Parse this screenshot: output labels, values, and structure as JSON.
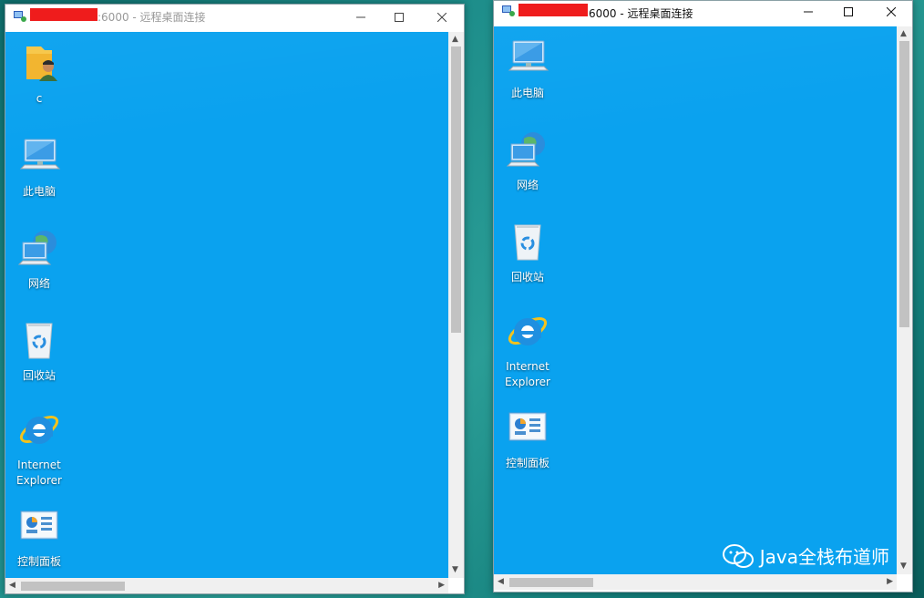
{
  "windows": [
    {
      "title_suffix": ":6000 - 远程桌面连接",
      "icons": [
        {
          "label": "c"
        },
        {
          "label": "此电脑"
        },
        {
          "label": "网络"
        },
        {
          "label": "回收站"
        },
        {
          "label": "Internet Explorer"
        },
        {
          "label": "控制面板"
        }
      ]
    },
    {
      "title_suffix": "6000 - 远程桌面连接",
      "icons": [
        {
          "label": "此电脑"
        },
        {
          "label": "网络"
        },
        {
          "label": "回收站"
        },
        {
          "label": "Internet Explorer"
        },
        {
          "label": "控制面板"
        }
      ]
    }
  ],
  "watermark": {
    "text": "Java全栈布道师"
  },
  "colors": {
    "desktop": "#0aa2ef",
    "redaction": "#ef1c1c"
  }
}
